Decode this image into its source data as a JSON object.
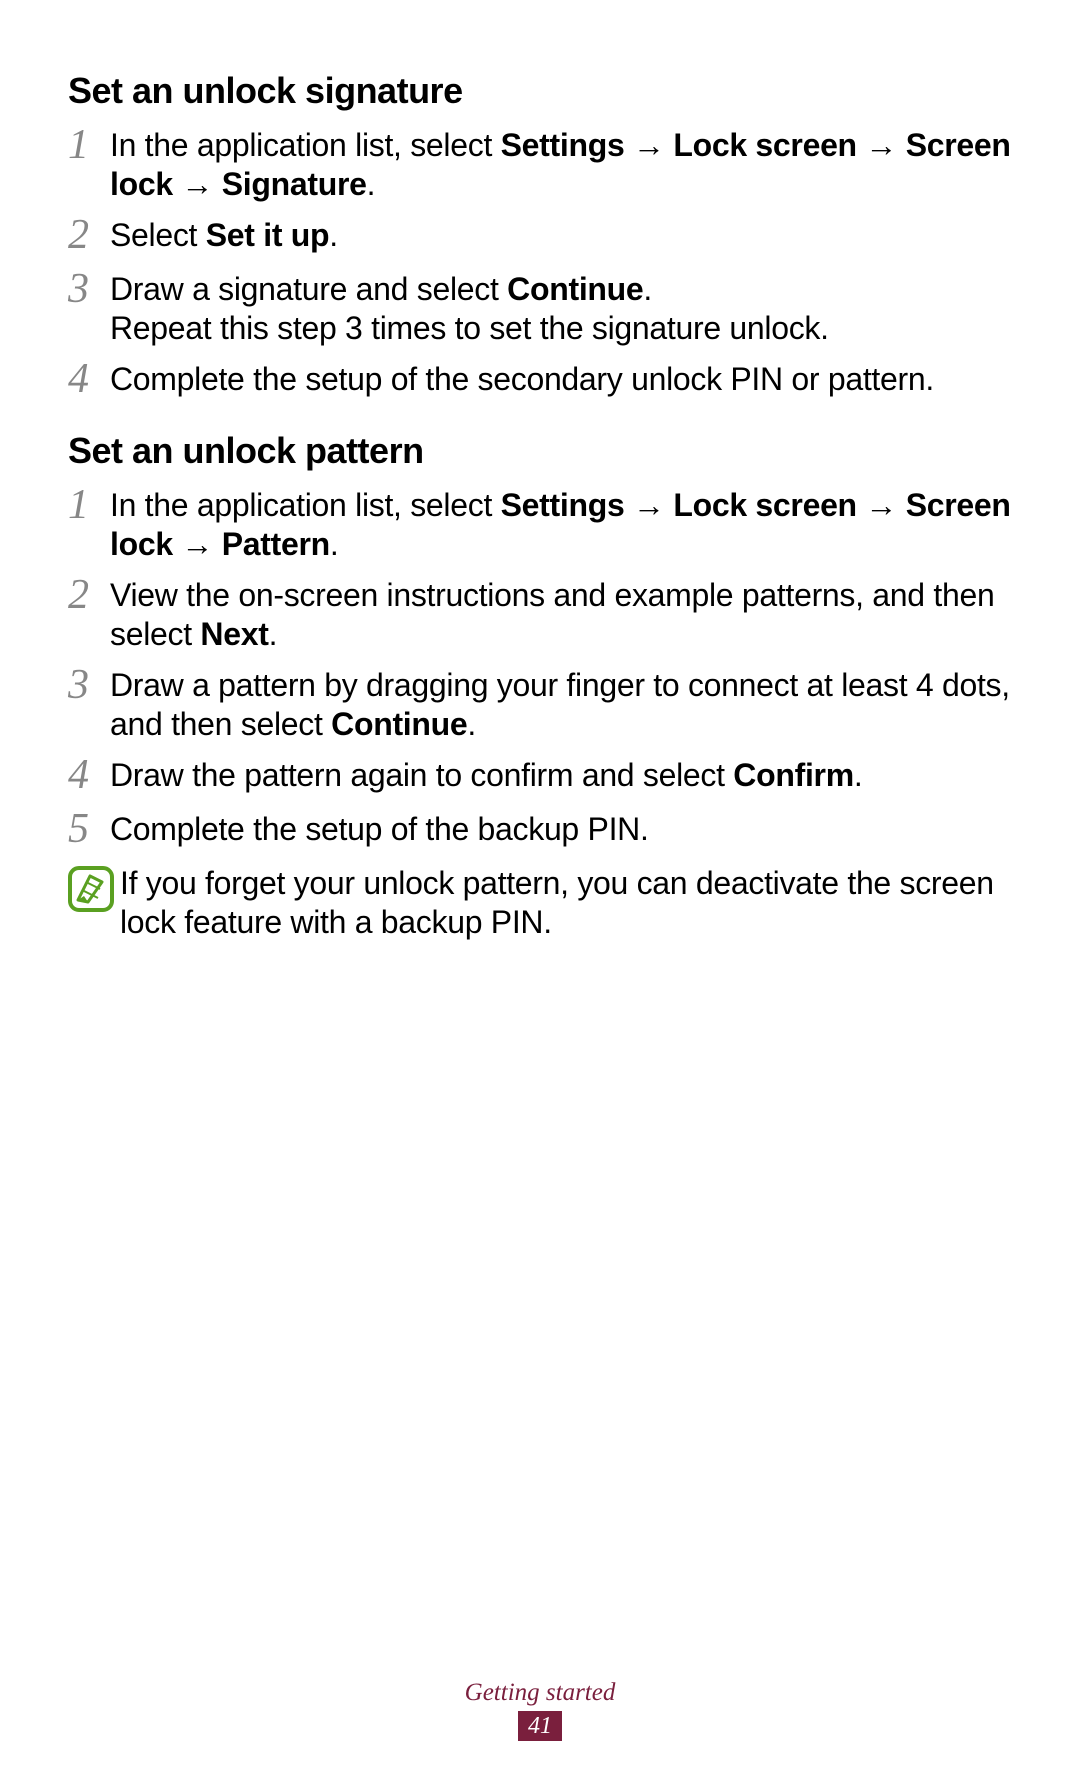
{
  "section1": {
    "heading": "Set an unlock signature",
    "steps": [
      {
        "num": "1",
        "pre": "In the application list, select ",
        "bold": "Settings → Lock screen → Screen lock → Signature",
        "post": "."
      },
      {
        "num": "2",
        "pre": "Select ",
        "bold": "Set it up",
        "post": "."
      },
      {
        "num": "3",
        "pre": "Draw a signature and select ",
        "bold": "Continue",
        "post": ".",
        "extra": "Repeat this step 3 times to set the signature unlock."
      },
      {
        "num": "4",
        "pre": "Complete the setup of the secondary unlock PIN or pattern.",
        "bold": "",
        "post": ""
      }
    ]
  },
  "section2": {
    "heading": "Set an unlock pattern",
    "steps": [
      {
        "num": "1",
        "pre": "In the application list, select ",
        "bold": "Settings → Lock screen → Screen lock → Pattern",
        "post": "."
      },
      {
        "num": "2",
        "pre": "View the on-screen instructions and example patterns, and then select ",
        "bold": "Next",
        "post": "."
      },
      {
        "num": "3",
        "pre": "Draw a pattern by dragging your finger to connect at least 4 dots, and then select ",
        "bold": "Continue",
        "post": "."
      },
      {
        "num": "4",
        "pre": "Draw the pattern again to confirm and select ",
        "bold": "Confirm",
        "post": "."
      },
      {
        "num": "5",
        "pre": "Complete the setup of the backup PIN.",
        "bold": "",
        "post": ""
      }
    ],
    "note": "If you forget your unlock pattern, you can deactivate the screen lock feature with a backup PIN."
  },
  "footer": {
    "title": "Getting started",
    "page": "41"
  }
}
